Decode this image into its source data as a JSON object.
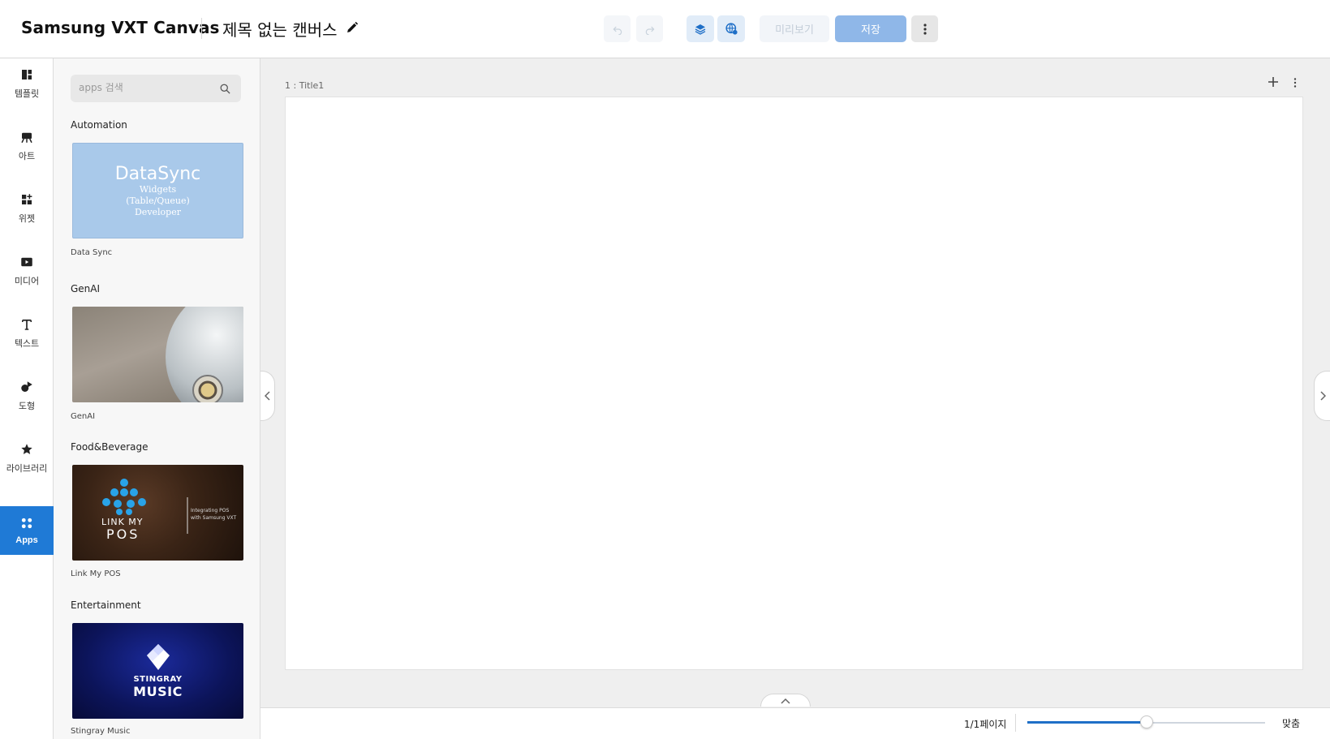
{
  "header": {
    "brand": "Samsung VXT Canvas",
    "doc_title": "제목 없는 캔버스",
    "preview_label": "미리보기",
    "save_label": "저장"
  },
  "rail": {
    "items": [
      {
        "label": "템플릿",
        "icon": "template-icon"
      },
      {
        "label": "아트",
        "icon": "art-icon"
      },
      {
        "label": "위젯",
        "icon": "widget-icon"
      },
      {
        "label": "미디어",
        "icon": "media-icon"
      },
      {
        "label": "텍스트",
        "icon": "text-icon"
      },
      {
        "label": "도형",
        "icon": "shape-icon"
      },
      {
        "label": "라이브러리",
        "icon": "star-icon"
      },
      {
        "label": "Apps",
        "icon": "apps-icon",
        "active": true
      }
    ]
  },
  "panel": {
    "search_placeholder": "apps 검색",
    "categories": [
      {
        "title": "Automation",
        "app": "Data Sync",
        "thumb_title": "DataSync",
        "thumb_lines": [
          "Widgets",
          "(Table/Queue)",
          "Developer"
        ]
      },
      {
        "title": "GenAI",
        "app": "GenAI"
      },
      {
        "title": "Food&Beverage",
        "app": "Link My POS",
        "thumb_title": "LINK MY",
        "thumb_title2": "POS",
        "thumb_lines": [
          "Integrating POS",
          "with Samsung VXT"
        ]
      },
      {
        "title": "Entertainment",
        "app": "Stingray Music",
        "thumb_title": "STINGRAY",
        "thumb_title2": "MUSIC"
      }
    ]
  },
  "canvas": {
    "page_label": "1 : Title1"
  },
  "footer": {
    "page_count": "1/1페이지",
    "fit_label": "맞춤",
    "zoom_fraction": 0.5
  },
  "colors": {
    "accent": "#1f7ad6",
    "save_bg": "#8fb7e8"
  }
}
